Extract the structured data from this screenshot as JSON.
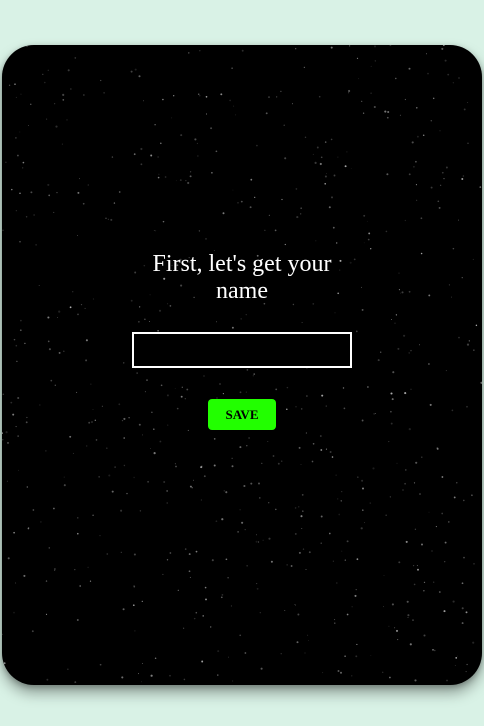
{
  "name_form": {
    "heading": "First, let's get your name",
    "input_value": "",
    "input_placeholder": "",
    "save_label": "SAVE"
  },
  "colors": {
    "page_background": "#d9f2e6",
    "card_background": "#000000",
    "accent_button": "#22ff00",
    "text": "#ffffff"
  }
}
